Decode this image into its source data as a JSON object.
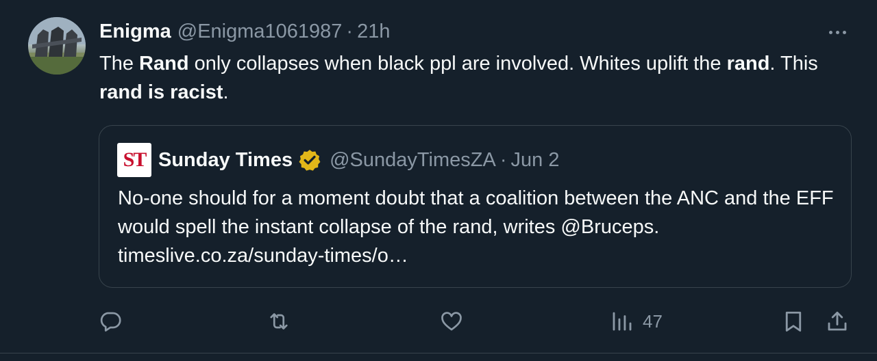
{
  "author": {
    "display_name": "Enigma",
    "handle": "@Enigma1061987",
    "separator": "·",
    "time": "21h"
  },
  "tweet": {
    "segments": [
      {
        "text": "The ",
        "bold": false
      },
      {
        "text": "Rand",
        "bold": true
      },
      {
        "text": " only collapses when black ppl are involved. Whites uplift the ",
        "bold": false
      },
      {
        "text": "rand",
        "bold": true
      },
      {
        "text": ". This ",
        "bold": false
      },
      {
        "text": "rand is racist",
        "bold": true
      },
      {
        "text": ".",
        "bold": false
      }
    ]
  },
  "quote": {
    "logo_text": "ST",
    "display_name": "Sunday Times",
    "verified": true,
    "handle": "@SundayTimesZA",
    "separator": "·",
    "time": "Jun 2",
    "text": "No-one should for a moment doubt that a coalition between the ANC and the EFF would spell the instant collapse of the rand, writes @Bruceps. timeslive.co.za/sunday-times/o…"
  },
  "actions": {
    "reply_icon": "reply-icon",
    "repost_icon": "repost-icon",
    "like_icon": "like-icon",
    "views_icon": "views-icon",
    "views_count": "47",
    "bookmark_icon": "bookmark-icon",
    "share_icon": "share-icon"
  },
  "colors": {
    "background": "#15202b",
    "text": "#f7f9f9",
    "secondary_text": "#8b98a5",
    "border": "#38444d",
    "verified_gold": "#e2b719",
    "logo_red": "#c8102e"
  }
}
